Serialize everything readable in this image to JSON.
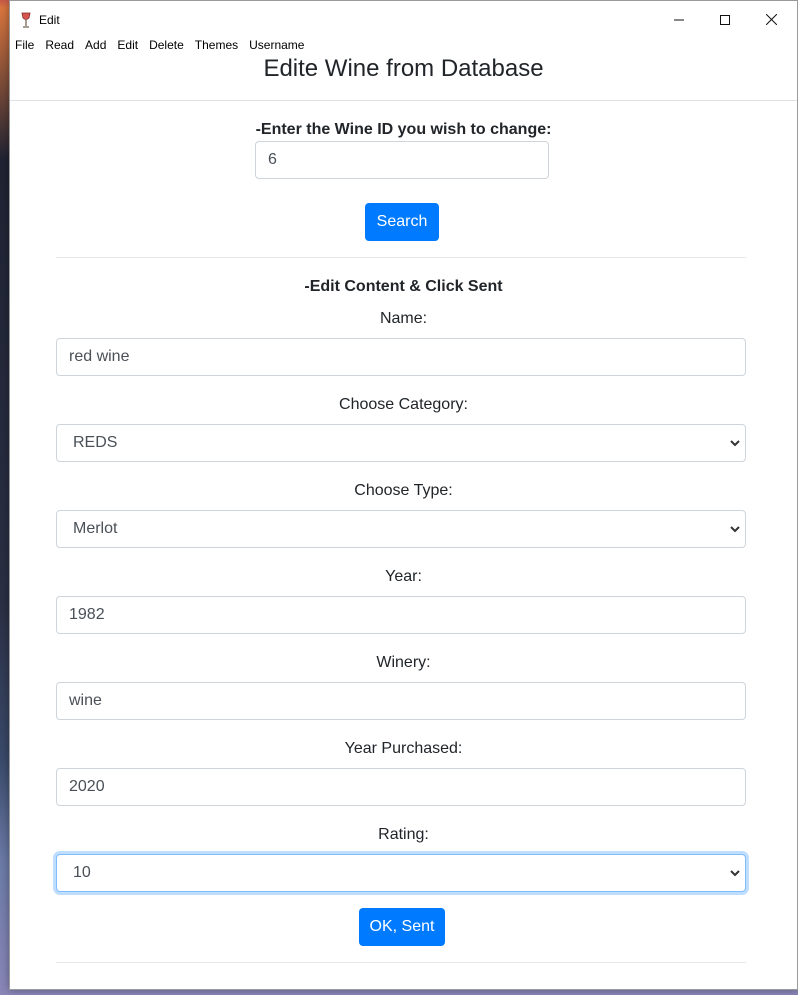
{
  "window": {
    "title": "Edit",
    "controls": {
      "minimize": "—",
      "maximize": "☐",
      "close": "✕"
    }
  },
  "menu": [
    "File",
    "Read",
    "Add",
    "Edit",
    "Delete",
    "Themes",
    "Username"
  ],
  "page": {
    "title": "Edite Wine from Database"
  },
  "search": {
    "label": "-Enter the Wine ID you wish to change:",
    "value": "6",
    "button": "Search"
  },
  "edit": {
    "heading": "-Edit Content & Click Sent",
    "name_label": "Name:",
    "name_value": "red wine",
    "category_label": "Choose Category:",
    "category_value": "REDS",
    "type_label": "Choose Type:",
    "type_value": "Merlot",
    "year_label": "Year:",
    "year_value": "1982",
    "winery_label": "Winery:",
    "winery_value": "wine",
    "purchased_label": "Year Purchased:",
    "purchased_value": "2020",
    "rating_label": "Rating:",
    "rating_value": "10",
    "submit": "OK, Sent"
  },
  "colors": {
    "primary": "#007bff",
    "focus_border": "#80bdff",
    "input_border": "#ced4da",
    "text": "#212529"
  },
  "icons": {
    "app": "wine-glass-icon",
    "select": "chevron-down-icon"
  }
}
